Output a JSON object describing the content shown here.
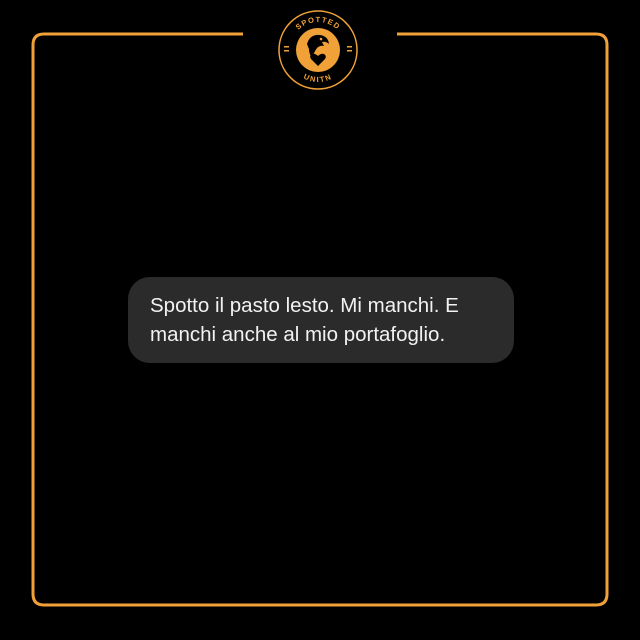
{
  "colors": {
    "background": "#000000",
    "accent": "#f0a238",
    "bubble": "#2b2b2b",
    "text": "#f2f2f2"
  },
  "logo": {
    "top_text": "SPOTTED",
    "bottom_text": "UNITN",
    "icon": "eagle-heart-emblem"
  },
  "message": {
    "line1": "Spotto il pasto lesto. Mi manchi. E",
    "line2": "manchi anche al mio portafoglio."
  }
}
